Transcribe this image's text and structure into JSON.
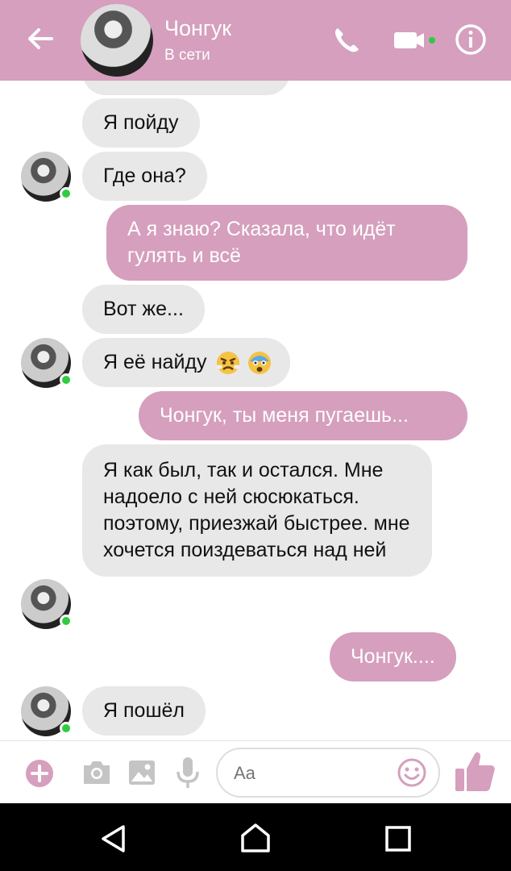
{
  "header": {
    "name": "Чонгук",
    "status": "В сети"
  },
  "messages": [
    {
      "from": "them",
      "text": "Я пойду"
    },
    {
      "from": "them",
      "text": "Где она?"
    },
    {
      "from": "me",
      "text": "А я знаю? Сказала, что идёт гулять и всё"
    },
    {
      "from": "them",
      "text": "Вот же..."
    },
    {
      "from": "them",
      "text": "Я её найду",
      "emoji": [
        "angry-face-icon",
        "fearful-face-icon"
      ]
    },
    {
      "from": "me",
      "text": "Чонгук,  ты меня пугаешь..."
    },
    {
      "from": "them",
      "text": "Я как был, так и остался. Мне надоело с ней сюсюкаться. поэтому, приезжай быстрее. мне хочется поиздеваться над ней"
    },
    {
      "from": "me",
      "text": "Чонгук...."
    },
    {
      "from": "them",
      "text": "Я пошёл"
    }
  ],
  "composer": {
    "placeholder": "Aa"
  },
  "colors": {
    "accent": "#d59fbd",
    "incoming_bubble": "#e8e8e8",
    "online": "#2ecc40"
  }
}
